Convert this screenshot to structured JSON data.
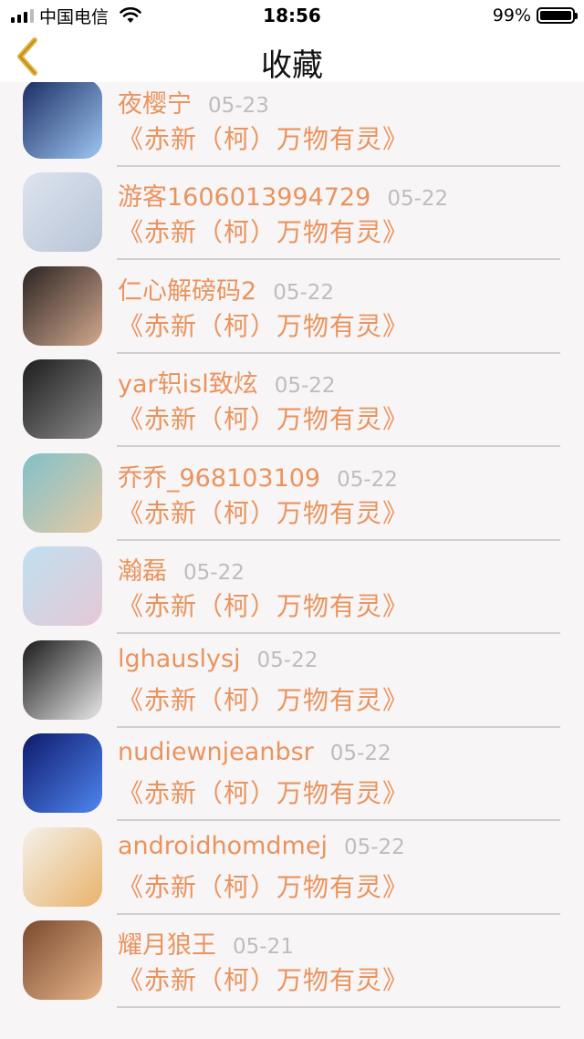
{
  "status_bar": {
    "carrier": "中国电信",
    "time": "18:56",
    "battery": "99%",
    "battery_level": 0.99
  },
  "nav": {
    "title": "收藏",
    "back_icon": "chevron-left-icon"
  },
  "items": [
    {
      "name": "",
      "date": "",
      "title": "《赤新（柯）万物有灵》",
      "avatar_colors": [
        "#e9d2ea",
        "#c79ad6"
      ]
    },
    {
      "name": "夜樱宁",
      "date": "05-23",
      "title": "《赤新（柯）万物有灵》",
      "avatar_colors": [
        "#1a2c63",
        "#9ec7f2"
      ]
    },
    {
      "name": "游客1606013994729",
      "date": "05-22",
      "title": "《赤新（柯）万物有灵》",
      "avatar_colors": [
        "#dde4ef",
        "#b8c4d6"
      ]
    },
    {
      "name": "仁心解磅码2",
      "date": "05-22",
      "title": "《赤新（柯）万物有灵》",
      "avatar_colors": [
        "#2b2422",
        "#d2a98f"
      ]
    },
    {
      "name": "yar轵isl致炫",
      "date": "05-22",
      "title": "《赤新（柯）万物有灵》",
      "avatar_colors": [
        "#1d1d1d",
        "#8b8b8b"
      ]
    },
    {
      "name": "乔乔_968103109",
      "date": "05-22",
      "title": "《赤新（柯）万物有灵》",
      "avatar_colors": [
        "#7fc1c9",
        "#e8c9a3"
      ]
    },
    {
      "name": "瀚磊",
      "date": "05-22",
      "title": "《赤新（柯）万物有灵》",
      "avatar_colors": [
        "#bfe0f0",
        "#e6c8d6"
      ]
    },
    {
      "name": "lghauslysj",
      "date": "05-22",
      "title": "《赤新（柯）万物有灵》",
      "avatar_colors": [
        "#1a1a1a",
        "#e8e8e8"
      ]
    },
    {
      "name": "nudiewnjeanbsr",
      "date": "05-22",
      "title": "《赤新（柯）万物有灵》",
      "avatar_colors": [
        "#0d1a6b",
        "#4f86f0"
      ]
    },
    {
      "name": "androidhomdmej",
      "date": "05-22",
      "title": "《赤新（柯）万物有灵》",
      "avatar_colors": [
        "#f3f1ea",
        "#e9b36b"
      ]
    },
    {
      "name": "耀月狼王",
      "date": "05-21",
      "title": "《赤新（柯）万物有灵》",
      "avatar_colors": [
        "#7a4a2f",
        "#e7b58a"
      ]
    }
  ]
}
